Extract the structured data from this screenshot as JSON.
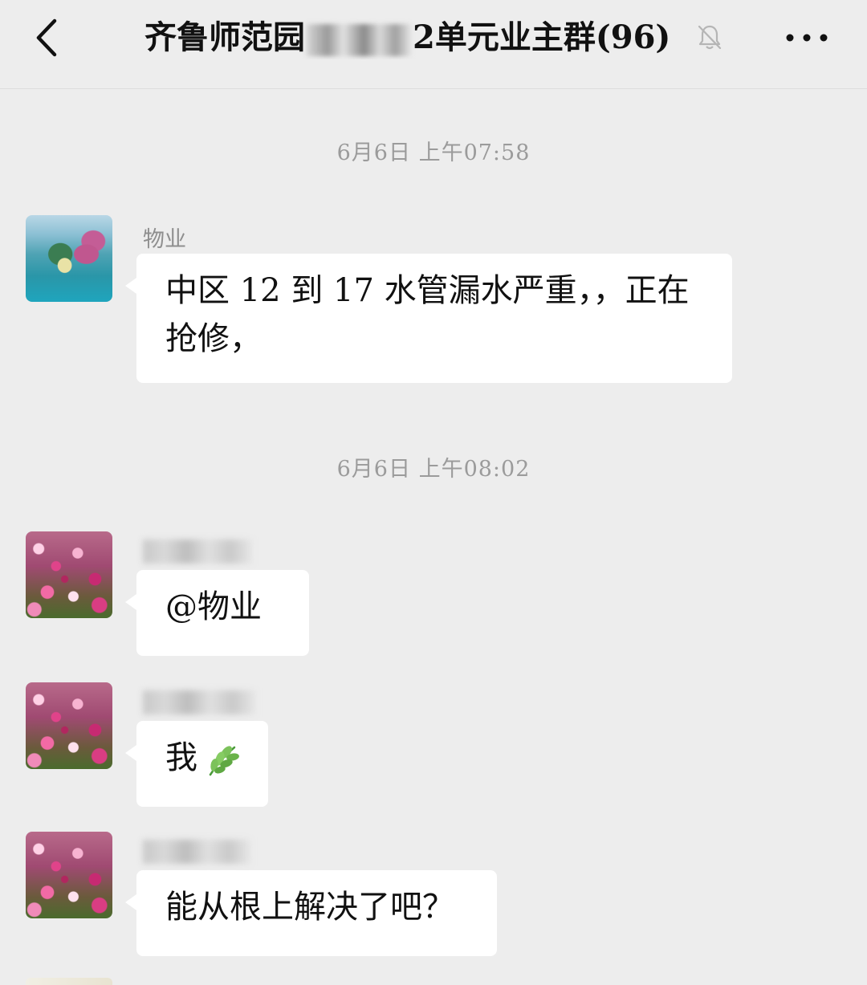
{
  "header": {
    "title_prefix": "齐鲁师范园",
    "title_suffix": "2单元业主群(96)",
    "back_icon": "chevron-left-icon",
    "mute_icon": "bell-off-icon",
    "more_icon": "more-dots-icon"
  },
  "messages": [
    {
      "time": "6月6日  上午07:58"
    },
    {
      "sender": "物业",
      "avatar": "sea-island-avatar",
      "text": "中区 12 到 17 水管漏水严重，，正在抢修，"
    },
    {
      "time": "6月6日  上午08:02"
    },
    {
      "sender": "",
      "avatar": "pink-flowers-avatar",
      "text": "@物业"
    },
    {
      "sender": "",
      "avatar": "pink-flowers-avatar",
      "text": "我",
      "emoji": "leaf-icon"
    },
    {
      "sender": "",
      "avatar": "pink-flowers-avatar",
      "text": "能从根上解决了吧？"
    }
  ],
  "colors": {
    "background": "#ededed",
    "bubble": "#ffffff",
    "timestamp": "#9b9b9b",
    "sender": "#8e8e8e"
  }
}
